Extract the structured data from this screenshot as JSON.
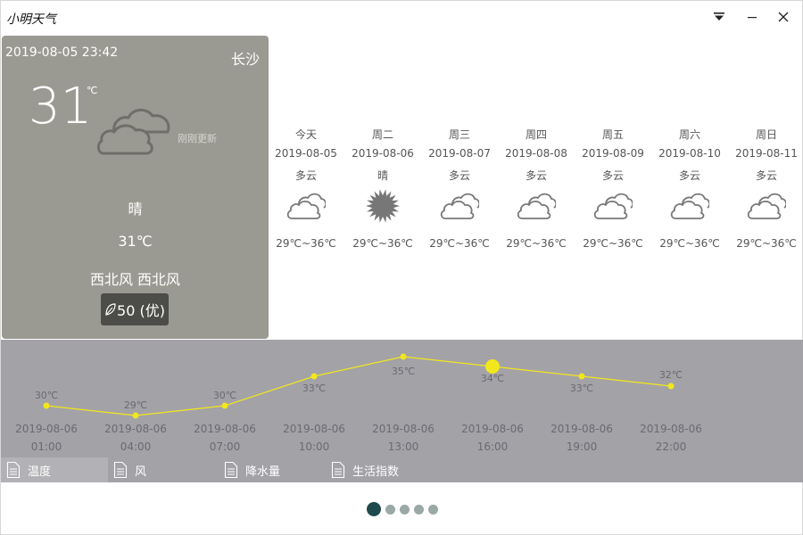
{
  "app": {
    "title": "小明天气"
  },
  "current": {
    "datetime": "2019-08-05 23:42",
    "city": "长沙",
    "temp": "31",
    "unit": "℃",
    "updated": "刚刚更新",
    "weather": "晴",
    "temp_text": "31℃",
    "wind": "西北风 西北风",
    "aqi": "50 (优)",
    "icon": "cloud-icon"
  },
  "forecast": [
    {
      "day": "今天",
      "date": "2019-08-05",
      "weather": "多云",
      "range": "29℃~36℃",
      "icon": "cloud-icon"
    },
    {
      "day": "周二",
      "date": "2019-08-06",
      "weather": "晴",
      "range": "29℃~36℃",
      "icon": "sun-icon"
    },
    {
      "day": "周三",
      "date": "2019-08-07",
      "weather": "多云",
      "range": "29℃~36℃",
      "icon": "cloud-icon"
    },
    {
      "day": "周四",
      "date": "2019-08-08",
      "weather": "多云",
      "range": "29℃~36℃",
      "icon": "cloud-icon"
    },
    {
      "day": "周五",
      "date": "2019-08-09",
      "weather": "多云",
      "range": "29℃~36℃",
      "icon": "cloud-icon"
    },
    {
      "day": "周六",
      "date": "2019-08-10",
      "weather": "多云",
      "range": "29℃~36℃",
      "icon": "cloud-icon"
    },
    {
      "day": "周日",
      "date": "2019-08-11",
      "weather": "多云",
      "range": "29℃~36℃",
      "icon": "cloud-icon"
    }
  ],
  "chart_data": {
    "type": "line",
    "x_dates": [
      "2019-08-06",
      "2019-08-06",
      "2019-08-06",
      "2019-08-06",
      "2019-08-06",
      "2019-08-06",
      "2019-08-06",
      "2019-08-06"
    ],
    "x_times": [
      "01:00",
      "04:00",
      "07:00",
      "10:00",
      "13:00",
      "16:00",
      "19:00",
      "22:00"
    ],
    "values": [
      30,
      29,
      30,
      33,
      35,
      34,
      33,
      32
    ],
    "value_labels": [
      "30℃",
      "29℃",
      "30℃",
      "33℃",
      "35℃",
      "34℃",
      "33℃",
      "32℃"
    ],
    "highlight_index": 5,
    "line_color": "#f2e71c"
  },
  "tabs": [
    {
      "label": "温度",
      "active": true
    },
    {
      "label": "风",
      "active": false
    },
    {
      "label": "降水量",
      "active": false
    },
    {
      "label": "生活指数",
      "active": false
    }
  ],
  "pager": {
    "count": 5,
    "active": 0
  },
  "colors": {
    "card_bg": "#9b9a92",
    "chart_bg": "#a3a2a7",
    "accent": "#f2e71c",
    "dot_active": "#1f4a4d"
  }
}
